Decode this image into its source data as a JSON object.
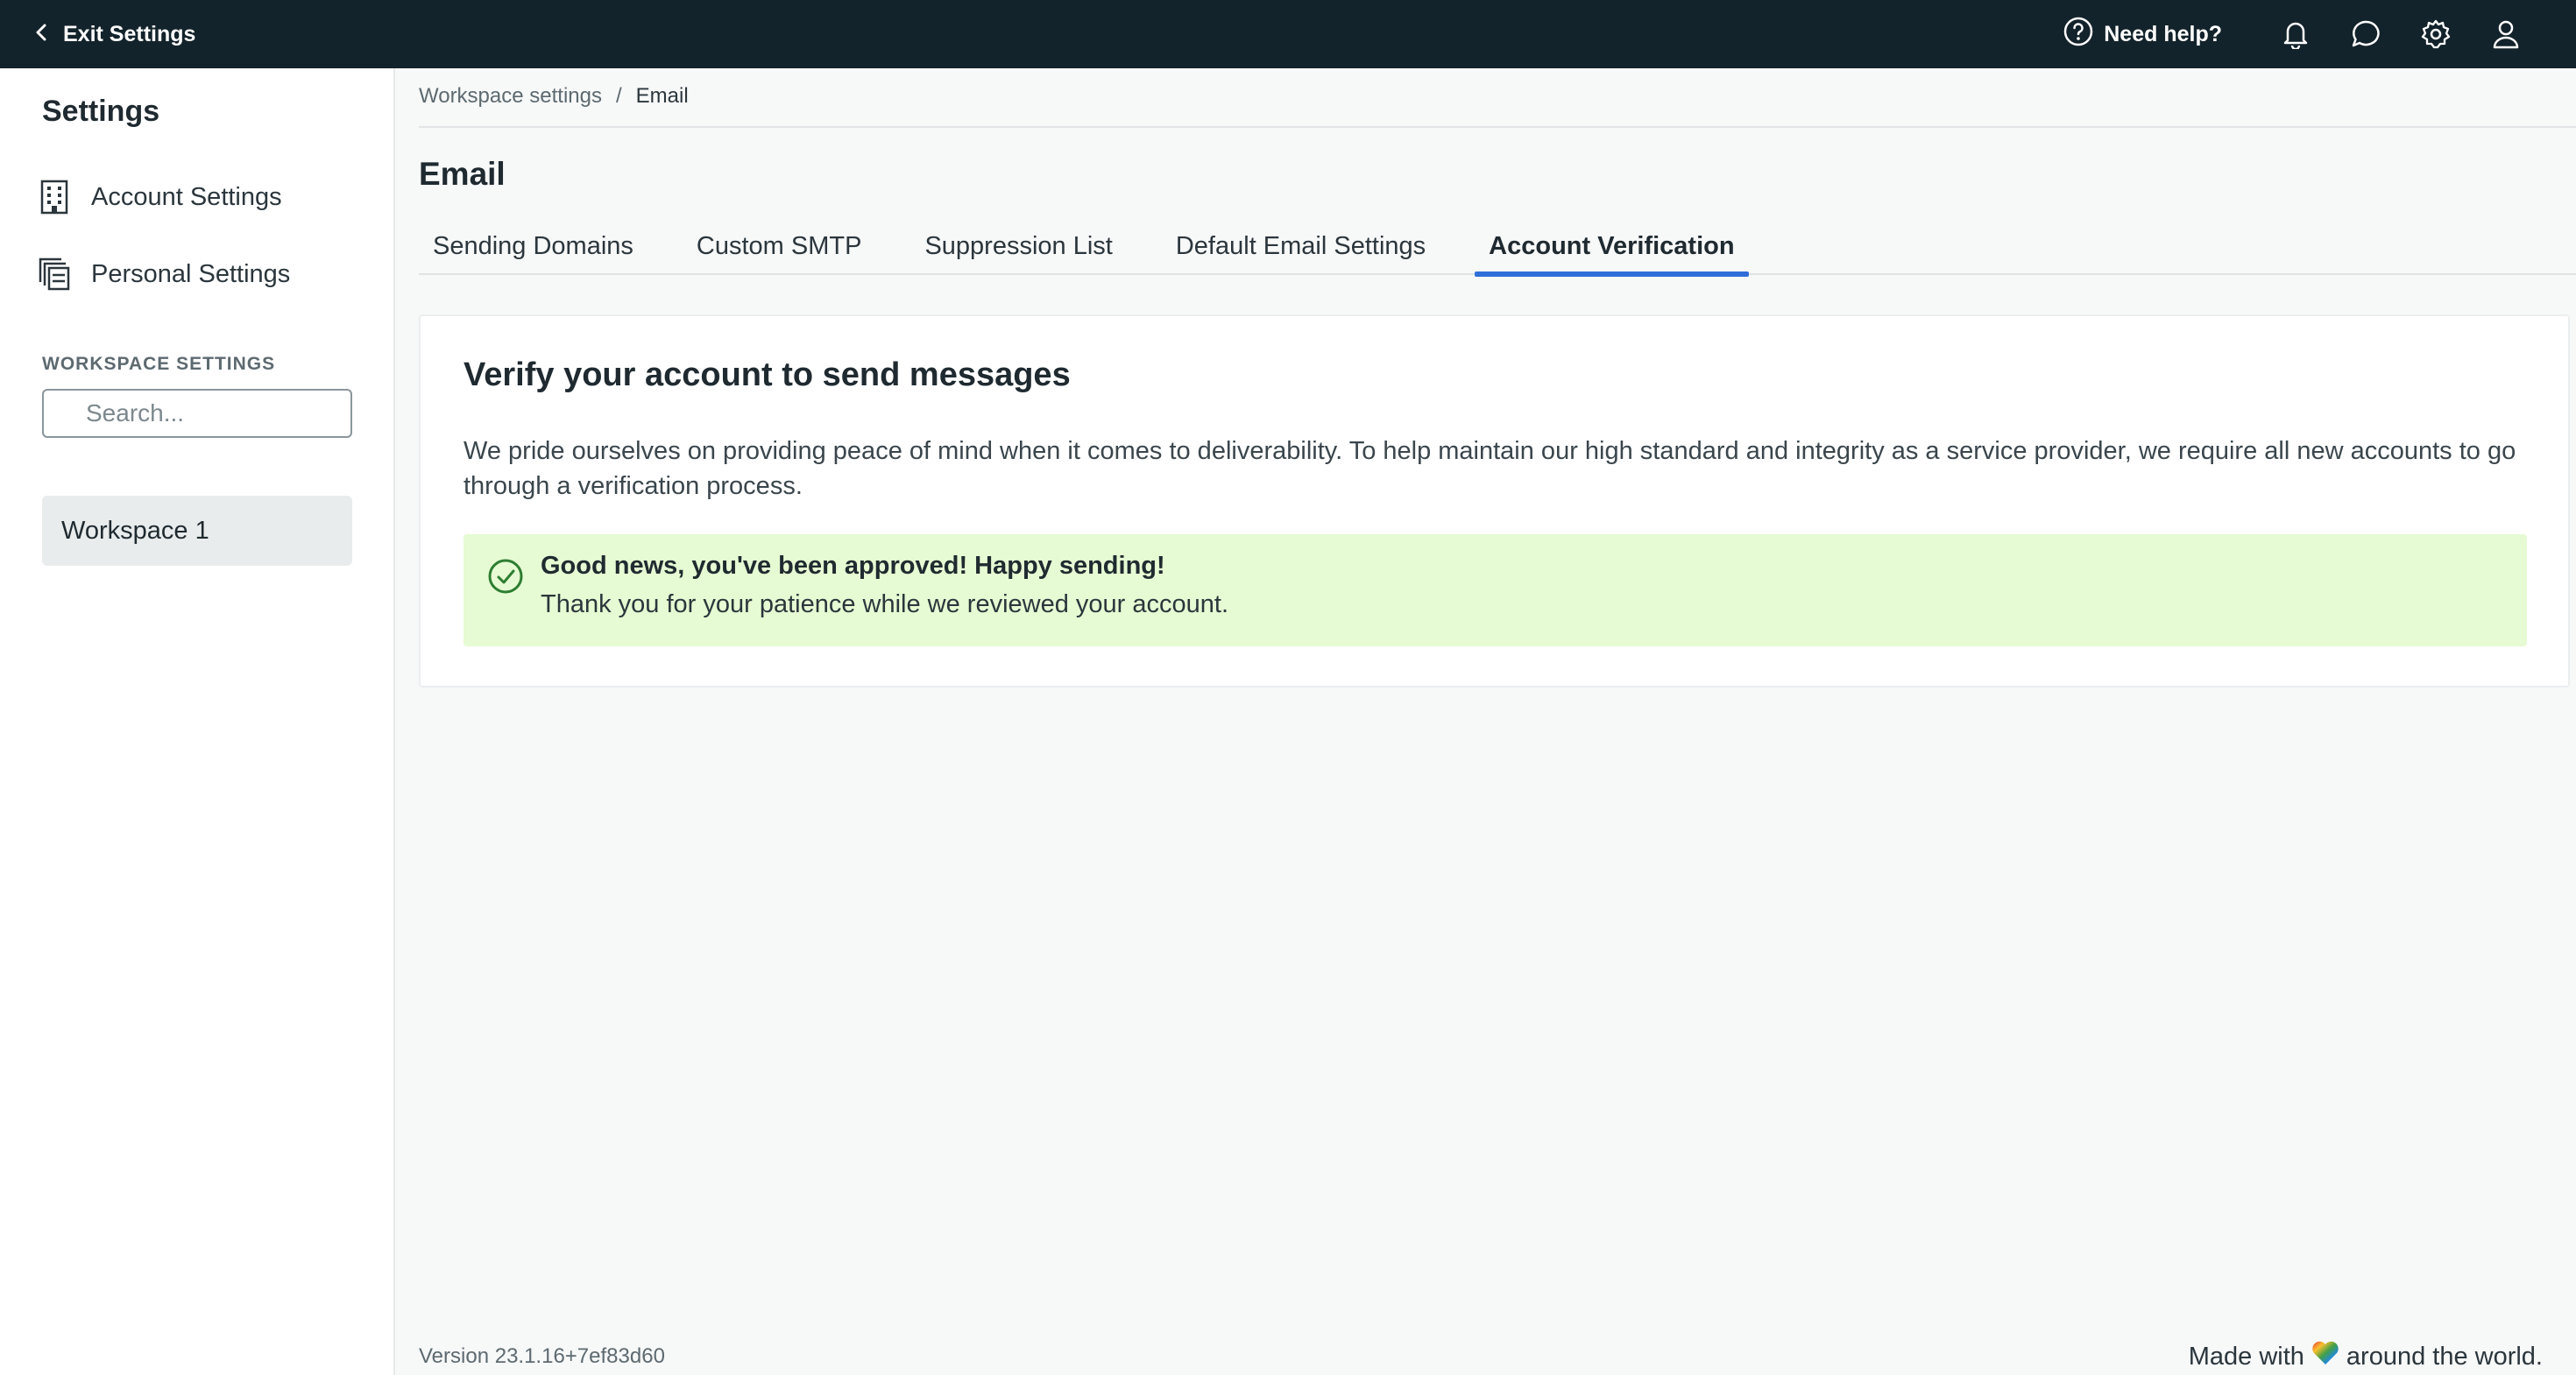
{
  "topbar": {
    "exit_label": "Exit Settings",
    "help_label": "Need help?",
    "icons": [
      "help-circle-icon",
      "bell-icon",
      "chat-icon",
      "gear-icon",
      "user-icon"
    ]
  },
  "sidebar": {
    "title": "Settings",
    "links": [
      {
        "label": "Account Settings",
        "icon": "building-icon"
      },
      {
        "label": "Personal Settings",
        "icon": "personal-settings-icon"
      }
    ],
    "section_label": "WORKSPACE SETTINGS",
    "search_placeholder": "Search...",
    "workspaces": [
      {
        "label": "Workspace 1"
      }
    ]
  },
  "breadcrumb": {
    "parent": "Workspace settings",
    "separator": "/",
    "current": "Email"
  },
  "page": {
    "title": "Email",
    "tabs": [
      {
        "label": "Sending Domains",
        "active": false
      },
      {
        "label": "Custom SMTP",
        "active": false
      },
      {
        "label": "Suppression List",
        "active": false
      },
      {
        "label": "Default Email Settings",
        "active": false
      },
      {
        "label": "Account Verification",
        "active": true
      }
    ]
  },
  "card": {
    "title": "Verify your account to send messages",
    "text": "We pride ourselves on providing peace of mind when it comes to deliverability. To help maintain our high standard and integrity as a service provider, we require all new accounts to go through a verification process.",
    "alert": {
      "title": "Good news, you've been approved! Happy sending!",
      "text": "Thank you for your patience while we reviewed your account.",
      "icon": "check-circle-icon"
    }
  },
  "footer": {
    "version": "Version 23.1.16+7ef83d60",
    "made_prefix": "Made with",
    "made_suffix": "around the world.",
    "heart_icon": "rainbow-heart-icon"
  },
  "colors": {
    "topbar_bg": "#13232b",
    "accent": "#2f6fd8",
    "success_bg": "#e6fbd3",
    "success_icon": "#2e7d32"
  }
}
